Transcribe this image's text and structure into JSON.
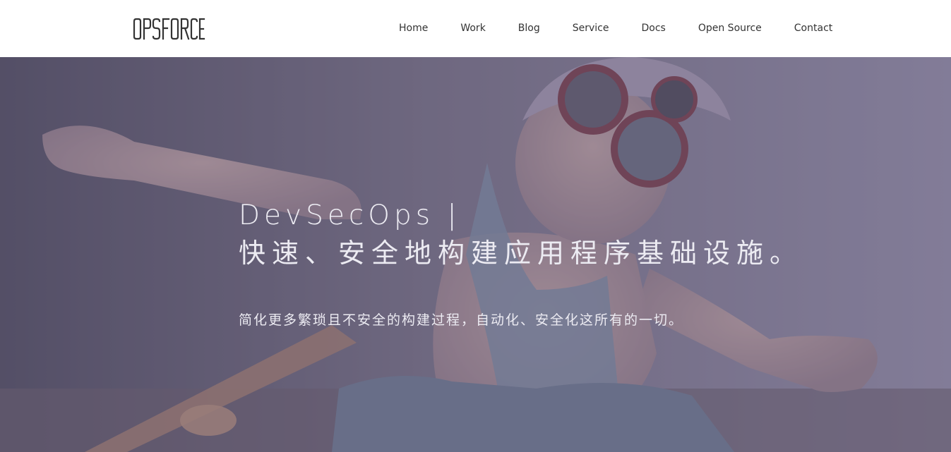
{
  "header": {
    "logo_text": "OPSFORCE",
    "nav": [
      {
        "label": "Home"
      },
      {
        "label": "Work"
      },
      {
        "label": "Blog"
      },
      {
        "label": "Service"
      },
      {
        "label": "Docs"
      },
      {
        "label": "Open Source"
      },
      {
        "label": "Contact"
      }
    ]
  },
  "hero": {
    "title_line1": "DevSecOps |",
    "title_line2": "快速、安全地构建应用程序基础设施。",
    "subtitle": "简化更多繁琐且不安全的构建过程，自动化、安全化这所有的一切。",
    "background_image": "child-aviator-photo",
    "overlay_color": "#766e8c"
  },
  "colors": {
    "nav_text": "#333333",
    "hero_text": "#ecebf2",
    "header_bg": "#ffffff"
  }
}
